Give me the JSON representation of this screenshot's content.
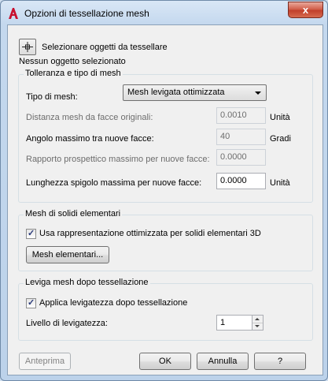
{
  "window": {
    "title": "Opzioni di tessellazione mesh",
    "close_label": "x"
  },
  "selection": {
    "button_label": "Selezionare oggetti da tessellare",
    "status": "Nessun oggetto selezionato"
  },
  "tolerance": {
    "group_title": "Tolleranza e tipo di mesh",
    "mesh_type_label": "Tipo di mesh:",
    "mesh_type_value": "Mesh levigata ottimizzata",
    "distance_label": "Distanza mesh da facce originali:",
    "distance_value": "0.0010",
    "distance_unit": "Unità",
    "angle_label": "Angolo massimo tra nuove facce:",
    "angle_value": "40",
    "angle_unit": "Gradi",
    "aspect_label": "Rapporto prospettico massimo per nuove facce:",
    "aspect_value": "0.0000",
    "edge_label": "Lunghezza spigolo massima per nuove facce:",
    "edge_value": "0.0000",
    "edge_unit": "Unità"
  },
  "primitives": {
    "group_title": "Mesh di solidi elementari",
    "checkbox_label": "Usa rappresentazione ottimizzata per solidi elementari 3D",
    "checked": true,
    "button_label": "Mesh elementari..."
  },
  "smoothing": {
    "group_title": "Leviga mesh dopo tessellazione",
    "checkbox_label": "Applica levigatezza dopo tessellazione",
    "checked": true,
    "level_label": "Livello di levigatezza:",
    "level_value": "1"
  },
  "footer": {
    "preview_label": "Anteprima",
    "ok_label": "OK",
    "cancel_label": "Annulla",
    "help_label": "?"
  }
}
